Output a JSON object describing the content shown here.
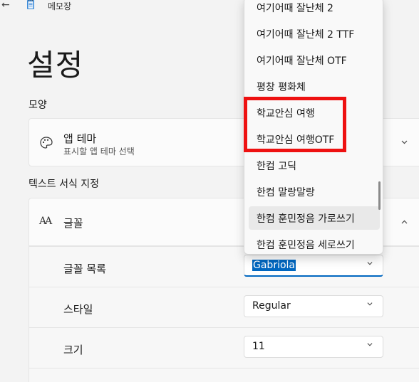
{
  "window": {
    "back_glyph": "←",
    "title": "메모장"
  },
  "page": {
    "title": "설정"
  },
  "appearance": {
    "section_label": "모양",
    "theme_title": "앱 테마",
    "theme_subtitle": "표시할 앱 테마 선택"
  },
  "text_format": {
    "section_label": "텍스트 서식 지정",
    "font_title": "글꼴",
    "font_icon_text": "AA",
    "font_list_label": "글꼴 목록",
    "font_list_value": "Gabriola",
    "style_label": "스타일",
    "style_value": "Regular",
    "size_label": "크기",
    "size_value": "11"
  },
  "font_dropdown": {
    "items": [
      "여기어때 잘난체 2",
      "여기어때 잘난체 2 TTF",
      "여기어때 잘난체 OTF",
      "평창 평화체",
      "학교안심 여행",
      "학교안심 여행OTF",
      "한컴 고딕",
      "한컴 말랑말랑",
      "한컴 훈민정음 가로쓰기",
      "한컴 훈민정음 세로쓰기"
    ],
    "hover_index": 8,
    "highlight_color": "#ee1111"
  },
  "colors": {
    "accent": "#0067c0",
    "background": "#f3f3f3"
  }
}
